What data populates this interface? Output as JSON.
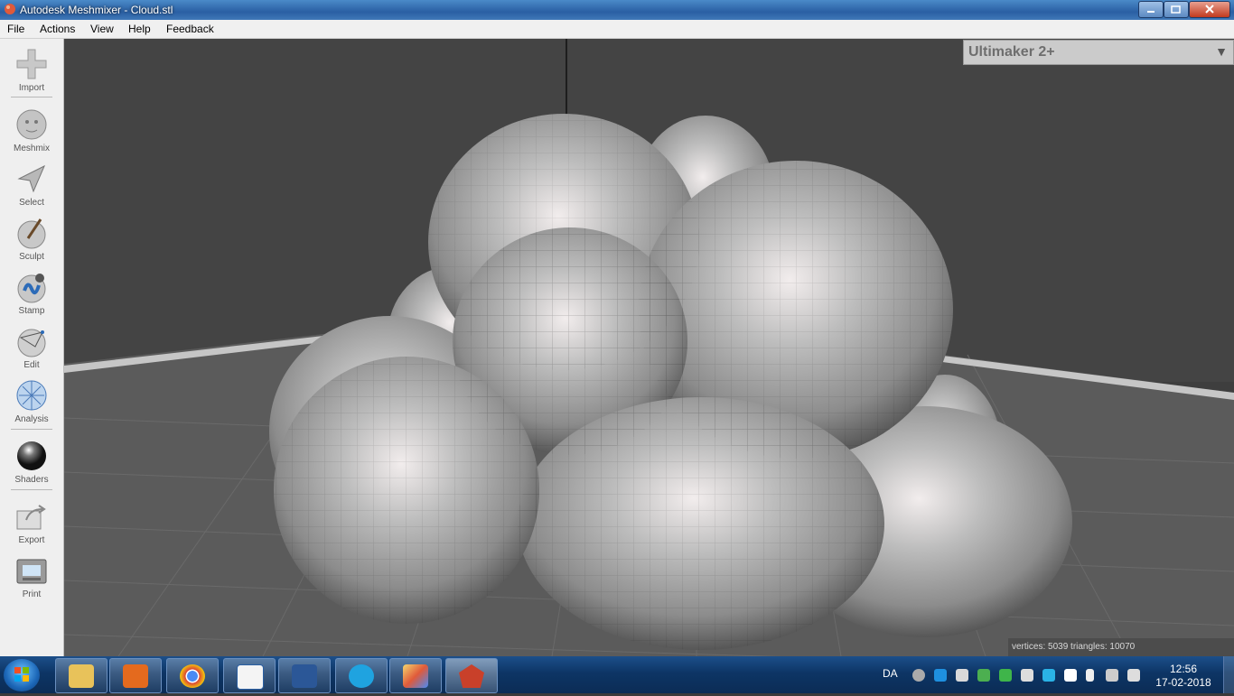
{
  "window": {
    "title": "Autodesk Meshmixer - Cloud.stl"
  },
  "menu": {
    "file": "File",
    "actions": "Actions",
    "view": "View",
    "help": "Help",
    "feedback": "Feedback"
  },
  "tools": {
    "import": "Import",
    "meshmix": "Meshmix",
    "select": "Select",
    "sculpt": "Sculpt",
    "stamp": "Stamp",
    "edit": "Edit",
    "analysis": "Analysis",
    "shaders": "Shaders",
    "export": "Export",
    "print": "Print"
  },
  "viewport": {
    "printer": "Ultimaker 2+",
    "stats": "vertices: 5039 triangles: 10070"
  },
  "taskbar": {
    "apps": [
      "windows-explorer",
      "media-player",
      "chrome",
      "document-viewer",
      "microsoft-word",
      "ccleaner",
      "paint",
      "meshmixer"
    ],
    "language": "DA",
    "time": "12:56",
    "date": "17-02-2018"
  },
  "colors": {
    "titlebar": "#2a5fa3",
    "toolbar": "#efefef",
    "viewport_bg": "#3e3e3e",
    "floor": "#5a5a5a",
    "mesh": "#a8a8a8"
  }
}
